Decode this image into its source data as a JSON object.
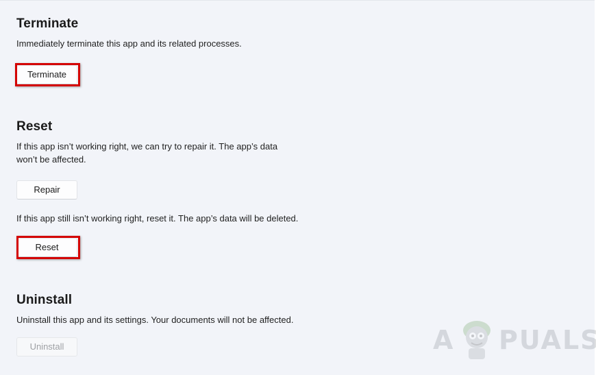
{
  "terminate": {
    "title": "Terminate",
    "description": "Immediately terminate this app and its related processes.",
    "button_label": "Terminate"
  },
  "reset": {
    "title": "Reset",
    "repair_description_line1": "If this app isn’t working right, we can try to repair it. The app’s data",
    "repair_description_line2": "won’t be affected.",
    "repair_button_label": "Repair",
    "reset_description": "If this app still isn’t working right, reset it. The app’s data will be deleted.",
    "reset_button_label": "Reset"
  },
  "uninstall": {
    "title": "Uninstall",
    "description": "Uninstall this app and its settings. Your documents will not be affected.",
    "button_label": "Uninstall",
    "button_disabled": true
  },
  "watermark": {
    "text_first": "A",
    "text_rest": "PUALS"
  },
  "colors": {
    "background": "#f2f4f9",
    "highlight": "#d40000",
    "disabled_text": "#9ea0a4"
  }
}
